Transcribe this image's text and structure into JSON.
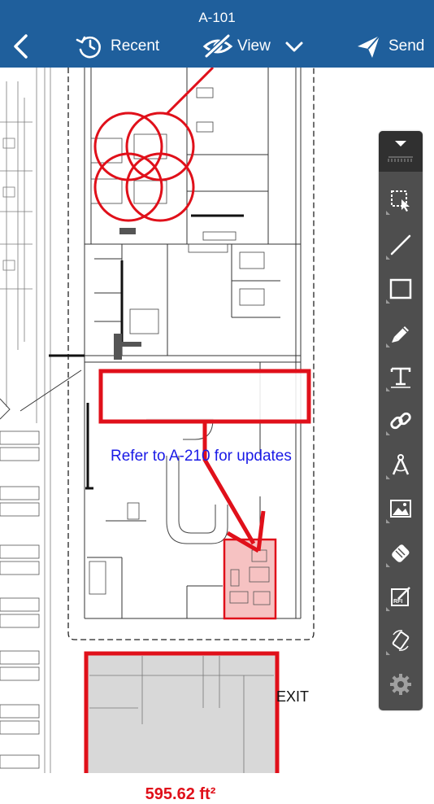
{
  "header": {
    "title": "A-101",
    "back_icon": "chevron-left-icon",
    "recent_label": "Recent",
    "recent_icon": "history-icon",
    "view_label": "View",
    "view_icon": "eye-hidden-icon",
    "view_dropdown_icon": "chevron-down-icon",
    "send_label": "Send",
    "send_icon": "paper-plane-icon",
    "bg_color": "#1f5f9c"
  },
  "drawing": {
    "callout_text": "Refer to A-210 for updates",
    "area_label": "595.62 ft²",
    "exit_label": "EXIT",
    "markup_color": "#e0101a",
    "text_color": "#1a1ae6"
  },
  "toolbar": {
    "collapse_icon": "triangle-down-icon",
    "tools": [
      {
        "name": "select-tool",
        "icon": "lasso-select-icon"
      },
      {
        "name": "line-tool",
        "icon": "line-icon"
      },
      {
        "name": "rectangle-tool",
        "icon": "rectangle-icon"
      },
      {
        "name": "pen-tool",
        "icon": "pen-icon"
      },
      {
        "name": "text-tool",
        "icon": "text-icon"
      },
      {
        "name": "link-tool",
        "icon": "link-icon"
      },
      {
        "name": "measure-tool",
        "icon": "compass-icon"
      },
      {
        "name": "image-tool",
        "icon": "image-icon"
      },
      {
        "name": "stamp-tool",
        "icon": "stamp-icon"
      },
      {
        "name": "rfi-tool",
        "icon": "rfi-icon"
      },
      {
        "name": "rotate-tool",
        "icon": "rotate-icon"
      },
      {
        "name": "settings-tool",
        "icon": "gear-icon"
      }
    ]
  }
}
